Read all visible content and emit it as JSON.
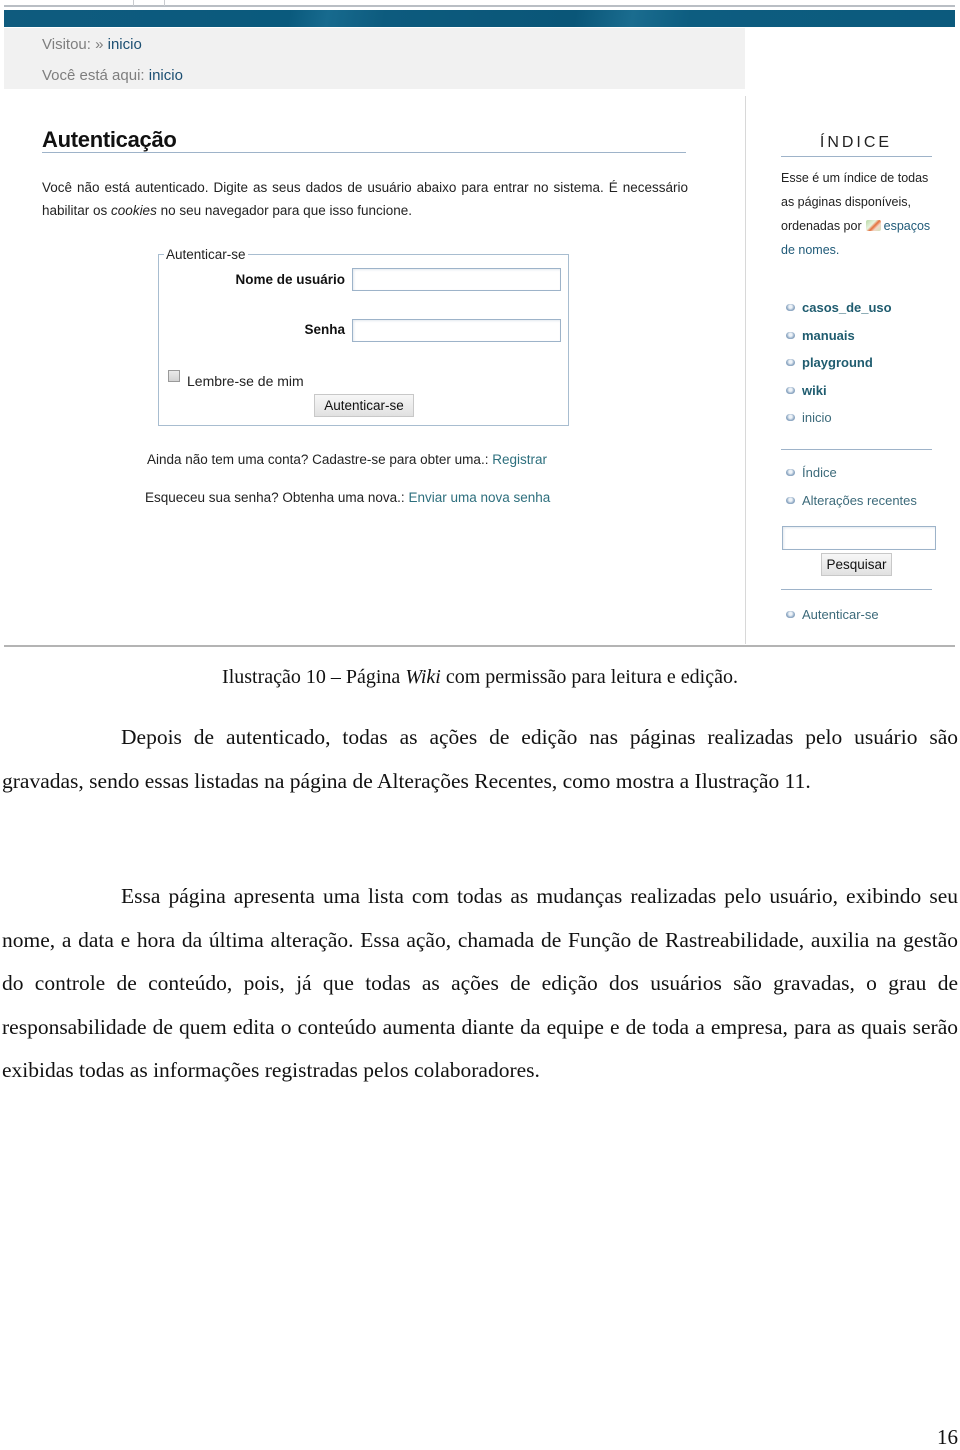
{
  "screenshot": {
    "breadcrumbs": {
      "visited_label": "Visitou: »",
      "visited_link": "inicio",
      "here_label": "Você está aqui:",
      "here_link": "inicio"
    },
    "auth": {
      "title": "Autenticação",
      "intro_before": "Você não está autenticado. Digite as seus dados de usuário abaixo para entrar no sistema. É necessário habilitar os ",
      "intro_em": "cookies",
      "intro_after": " no seu navegador para que isso funcione.",
      "legend": "Autenticar-se",
      "username_label": "Nome de usuário",
      "username_value": "",
      "password_label": "Senha",
      "password_value": "",
      "remember_label": "Lembre-se de mim",
      "remember_checked": false,
      "submit_label": "Autenticar-se",
      "register_text": "Ainda não tem uma conta? Cadastre-se para obter uma.:",
      "register_link": "Registrar",
      "reset_text": "Esqueceu sua senha? Obtenha uma nova.:",
      "reset_link": "Enviar uma nova senha"
    },
    "sidebar": {
      "title": "ÍNDICE",
      "desc_before": "Esse é um índice de todas as páginas disponíveis, ordenadas por",
      "desc_link": "espaços de nomes.",
      "namespaces": [
        {
          "label": "casos_de_uso",
          "icon": "bullet-icon"
        },
        {
          "label": "manuais",
          "icon": "bullet-icon"
        },
        {
          "label": "playground",
          "icon": "bullet-icon"
        },
        {
          "label": "wiki",
          "icon": "bullet-icon"
        },
        {
          "label": "inicio",
          "icon": "bullet-icon"
        }
      ],
      "tools": [
        {
          "label": "Índice",
          "icon": "bullet-icon"
        },
        {
          "label": "Alterações recentes",
          "icon": "bullet-icon"
        }
      ],
      "search_value": "",
      "search_button": "Pesquisar",
      "login_link": "Autenticar-se"
    },
    "colors": {
      "banner": "#0c5a7d",
      "link": "#1f5c6f",
      "rule": "#9eb3c9"
    }
  },
  "document": {
    "caption_before": "Ilustração 10 – Página ",
    "caption_em": "Wiki",
    "caption_after": " com permissão para leitura e edição.",
    "paragraphs": [
      "Depois de autenticado, todas as ações de edição nas páginas realizadas pelo usuário são gravadas, sendo essas listadas na página de Alterações Recentes, como mostra a Ilustração 11.",
      "Essa página apresenta uma lista com todas as mudanças realizadas pelo usuário, exibindo seu nome, a data e hora da última alteração. Essa ação, chamada de Função de Rastreabilidade, auxilia na gestão do controle de conteúdo, pois, já que todas as ações de edição dos usuários são gravadas, o grau de responsabilidade de quem edita o conteúdo aumenta diante da equipe e de toda a empresa, para as quais serão exibidas todas as informações registradas pelos colaboradores."
    ],
    "page_number": "16"
  }
}
